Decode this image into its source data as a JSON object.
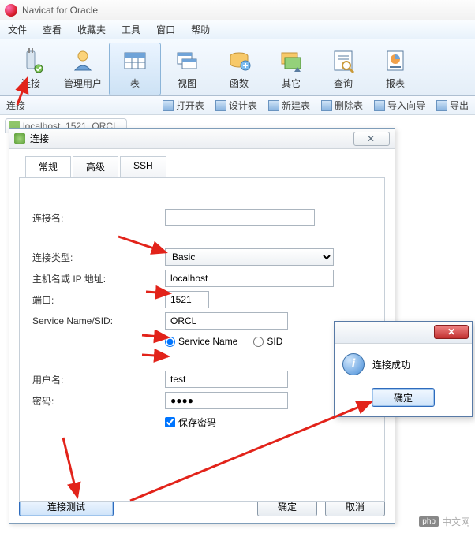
{
  "app_title": "Navicat for Oracle",
  "menu": [
    "文件",
    "查看",
    "收藏夹",
    "工具",
    "窗口",
    "帮助"
  ],
  "ribbon": [
    {
      "key": "connect",
      "label": "连接"
    },
    {
      "key": "users",
      "label": "管理用户"
    },
    {
      "key": "table",
      "label": "表",
      "selected": true
    },
    {
      "key": "view",
      "label": "视图"
    },
    {
      "key": "function",
      "label": "函数"
    },
    {
      "key": "other",
      "label": "其它"
    },
    {
      "key": "query",
      "label": "查询"
    },
    {
      "key": "report",
      "label": "报表"
    }
  ],
  "subtoolbar": {
    "left": "连接",
    "items": [
      "打开表",
      "设计表",
      "新建表",
      "删除表",
      "导入向导",
      "导出"
    ]
  },
  "tree_tab": "localhost_1521_ORCL",
  "dialog": {
    "title": "连接",
    "close_glyph": "✕",
    "tabs": [
      "常规",
      "高级",
      "SSH"
    ],
    "labels": {
      "name": "连接名:",
      "type": "连接类型:",
      "host": "主机名或 IP 地址:",
      "port": "端口:",
      "sid": "Service Name/SID:",
      "user": "用户名:",
      "pass": "密码:"
    },
    "values": {
      "name": "",
      "type": "Basic",
      "host": "localhost",
      "port": "1521",
      "sid": "ORCL",
      "user": "test",
      "pass": "●●●●"
    },
    "radio": {
      "service": "Service Name",
      "sid": "SID",
      "selected": "service"
    },
    "save_pass": "保存密码",
    "buttons": {
      "test": "连接测试",
      "ok": "确定",
      "cancel": "取消"
    }
  },
  "msgbox": {
    "text": "连接成功",
    "ok": "确定",
    "close_glyph": "✕"
  },
  "watermark": {
    "badge": "php",
    "text": "中文网"
  }
}
